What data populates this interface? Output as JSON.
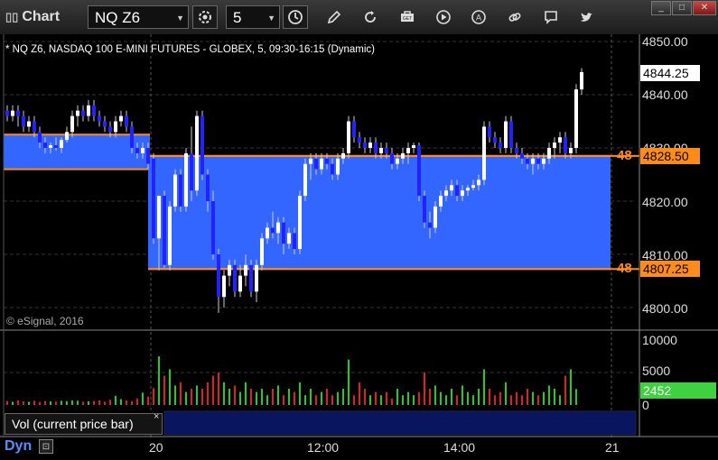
{
  "app": {
    "title": "Chart",
    "grip_icon": "grip-icon"
  },
  "toolbar": {
    "symbol": "NQ Z6",
    "interval": "5",
    "buttons": [
      "settings-gear-icon",
      "clock-icon",
      "pencil-draw-icon",
      "refresh-icon",
      "toolbox-icon",
      "play-icon",
      "alert-icon",
      "link-icon",
      "comment-icon",
      "twitter-icon"
    ],
    "get_label": "GET",
    "alert_label": "A"
  },
  "window": {
    "min": "_",
    "max": "□",
    "close": "✕"
  },
  "chart": {
    "info": "* NQ Z6, NASDAQ 100 E-MINI FUTURES - GLOBEX, 5, 09:30-16:15 (Dynamic)",
    "copyright": "© eSignal, 2016",
    "price_axis": [
      "4850.00",
      "4840.00",
      "4830.00",
      "4820.00",
      "4810.00",
      "4800.00"
    ],
    "volume_axis": [
      "10000",
      "5000",
      "0"
    ],
    "time_axis": [
      "20",
      "12:00",
      "14:00",
      "21"
    ],
    "last_price": "4844.25",
    "level_high": "4828.50",
    "level_low": "4807.25",
    "level_label": "48",
    "last_volume": "2452",
    "colors": {
      "up": "#ffffff",
      "down": "#2222ff",
      "zone": "#3366ff",
      "level": "#ff8c1a",
      "vol_up": "#1fcf1f",
      "vol_down": "#e02020"
    }
  },
  "volume_panel": {
    "label": "Vol (current price bar)",
    "close": "×"
  },
  "status": {
    "dyn": "Dyn"
  },
  "chart_data": {
    "type": "candlestick",
    "ylim": [
      4797,
      4852
    ],
    "levels": [
      4828.5,
      4807.25
    ],
    "zones": [
      {
        "x_from": 0,
        "x_to": 27,
        "y_from": 4826,
        "y_to": 4832.5
      },
      {
        "x_from": 27,
        "x_to": 112,
        "y_from": 4807.25,
        "y_to": 4828.5
      }
    ],
    "x_ticks": {
      "20": 27,
      "12:00": 59,
      "14:00": 84,
      "21": 112
    },
    "candles": [
      [
        4837,
        4838,
        4835,
        4836
      ],
      [
        4836,
        4838,
        4835,
        4837
      ],
      [
        4837,
        4838,
        4834,
        4836
      ],
      [
        4836,
        4837,
        4833,
        4834
      ],
      [
        4834,
        4836,
        4833,
        4835
      ],
      [
        4835,
        4836,
        4832,
        4833
      ],
      [
        4833,
        4834,
        4830,
        4831
      ],
      [
        4831,
        4832,
        4829,
        4830
      ],
      [
        4830,
        4831,
        4829,
        4830.5
      ],
      [
        4830.5,
        4832,
        4829.5,
        4830
      ],
      [
        4830,
        4832,
        4829,
        4831.5
      ],
      [
        4831.5,
        4834,
        4831,
        4833
      ],
      [
        4833,
        4837,
        4832,
        4836
      ],
      [
        4836,
        4838,
        4834,
        4837
      ],
      [
        4837,
        4838,
        4835,
        4836
      ],
      [
        4836,
        4839,
        4835,
        4838
      ],
      [
        4838,
        4839,
        4835,
        4836
      ],
      [
        4836,
        4837,
        4834,
        4835
      ],
      [
        4835,
        4836,
        4833,
        4834
      ],
      [
        4834,
        4835,
        4832,
        4833
      ],
      [
        4833,
        4836,
        4832,
        4835
      ],
      [
        4835,
        4837,
        4834,
        4836
      ],
      [
        4836,
        4837,
        4833,
        4834
      ],
      [
        4834,
        4835,
        4829,
        4830
      ],
      [
        4830,
        4831,
        4828,
        4829
      ],
      [
        4829,
        4831,
        4828,
        4830
      ],
      [
        4830,
        4831,
        4826,
        4827
      ],
      [
        4828,
        4829,
        4812,
        4813
      ],
      [
        4813,
        4821,
        4807,
        4821
      ],
      [
        4821,
        4822,
        4807.5,
        4808
      ],
      [
        4808,
        4820,
        4807,
        4819
      ],
      [
        4819,
        4826,
        4818,
        4825
      ],
      [
        4825,
        4826,
        4818,
        4819
      ],
      [
        4819,
        4830,
        4818,
        4829
      ],
      [
        4829,
        4834,
        4820,
        4822
      ],
      [
        4822,
        4837,
        4821,
        4836
      ],
      [
        4836,
        4837,
        4824,
        4825
      ],
      [
        4825,
        4826,
        4818,
        4820
      ],
      [
        4820,
        4822,
        4809,
        4810
      ],
      [
        4810,
        4811,
        4799,
        4802
      ],
      [
        4802,
        4807,
        4800,
        4806
      ],
      [
        4806,
        4809,
        4804,
        4808
      ],
      [
        4808,
        4809,
        4802,
        4803
      ],
      [
        4803,
        4808,
        4802,
        4806
      ],
      [
        4806,
        4810,
        4804,
        4808
      ],
      [
        4808,
        4809,
        4802,
        4803
      ],
      [
        4803,
        4809,
        4801,
        4808
      ],
      [
        4808,
        4814,
        4807,
        4813
      ],
      [
        4813,
        4816,
        4812,
        4815
      ],
      [
        4815,
        4818,
        4813,
        4814
      ],
      [
        4814,
        4817,
        4812,
        4816
      ],
      [
        4816,
        4817,
        4810,
        4812
      ],
      [
        4812,
        4815,
        4811,
        4814
      ],
      [
        4814,
        4815,
        4810,
        4811
      ],
      [
        4811,
        4822,
        4810,
        4821
      ],
      [
        4821,
        4828,
        4820,
        4827
      ],
      [
        4827,
        4829,
        4824,
        4828
      ],
      [
        4828,
        4829,
        4825,
        4826
      ],
      [
        4826,
        4829,
        4825,
        4828
      ],
      [
        4828,
        4829,
        4826,
        4827
      ],
      [
        4827,
        4828,
        4824,
        4825
      ],
      [
        4825,
        4829,
        4824,
        4828
      ],
      [
        4828,
        4830,
        4827,
        4829
      ],
      [
        4829,
        4836,
        4828,
        4835
      ],
      [
        4835,
        4836,
        4831,
        4832
      ],
      [
        4832,
        4833,
        4830,
        4831
      ],
      [
        4831,
        4832,
        4829,
        4830
      ],
      [
        4830,
        4832,
        4829,
        4831
      ],
      [
        4831,
        4832,
        4828,
        4829
      ],
      [
        4829,
        4831,
        4828,
        4830
      ],
      [
        4830,
        4831,
        4828,
        4829
      ],
      [
        4829,
        4830,
        4826,
        4827
      ],
      [
        4827,
        4829,
        4826,
        4828
      ],
      [
        4828,
        4830,
        4827,
        4829
      ],
      [
        4829,
        4831,
        4827,
        4830
      ],
      [
        4830,
        4831,
        4829,
        4830.5
      ],
      [
        4830.5,
        4831,
        4820,
        4821
      ],
      [
        4821,
        4822,
        4815,
        4816
      ],
      [
        4816,
        4818,
        4813,
        4815
      ],
      [
        4815,
        4820,
        4814,
        4819
      ],
      [
        4819,
        4822,
        4818,
        4821
      ],
      [
        4821,
        4823,
        4820,
        4822
      ],
      [
        4822,
        4824,
        4821,
        4823
      ],
      [
        4823,
        4824,
        4820,
        4821
      ],
      [
        4821,
        4823,
        4820,
        4822
      ],
      [
        4822,
        4823,
        4821,
        4822.5
      ],
      [
        4822.5,
        4824,
        4822,
        4823
      ],
      [
        4823,
        4825,
        4822,
        4824
      ],
      [
        4824,
        4835,
        4823,
        4834
      ],
      [
        4834,
        4835,
        4831,
        4832
      ],
      [
        4832,
        4833,
        4830,
        4831
      ],
      [
        4831,
        4832,
        4829,
        4830
      ],
      [
        4830,
        4836,
        4829,
        4835
      ],
      [
        4835,
        4836,
        4829,
        4830
      ],
      [
        4830,
        4831,
        4828,
        4829
      ],
      [
        4829,
        4830,
        4827,
        4828
      ],
      [
        4828,
        4829,
        4826,
        4827
      ],
      [
        4827,
        4829,
        4825,
        4828
      ],
      [
        4828,
        4829,
        4826,
        4827
      ],
      [
        4827,
        4829,
        4826,
        4828
      ],
      [
        4828,
        4831,
        4827,
        4830
      ],
      [
        4830,
        4832,
        4828,
        4831
      ],
      [
        4831,
        4833,
        4829,
        4832
      ],
      [
        4832,
        4833,
        4828,
        4829
      ],
      [
        4829,
        4831,
        4828,
        4830
      ],
      [
        4830,
        4842,
        4829,
        4841
      ],
      [
        4841,
        4845,
        4840,
        4844.25
      ]
    ],
    "volumes": [
      600,
      500,
      700,
      550,
      500,
      650,
      450,
      600,
      550,
      500,
      650,
      600,
      700,
      650,
      500,
      550,
      600,
      700,
      500,
      800,
      1400,
      900,
      700,
      600,
      1000,
      1900,
      1300,
      2600,
      7500,
      4500,
      5500,
      3000,
      3500,
      2000,
      2500,
      3000,
      2500,
      3500,
      4500,
      5000,
      3500,
      2500,
      3000,
      2000,
      3500,
      2500,
      2000,
      2500,
      1500,
      2500,
      3000,
      1500,
      2500,
      2000,
      3500,
      1500,
      2500,
      1500,
      2000,
      2500,
      1500,
      2000,
      2500,
      7000,
      1500,
      3500,
      2500,
      1500,
      2000,
      1500,
      2000,
      1000,
      2500,
      1500,
      2000,
      1500,
      2000,
      5000,
      2500,
      3000,
      2000,
      1500,
      2500,
      1500,
      3000,
      2000,
      1500,
      2500,
      5500,
      2500,
      1500,
      2000,
      3500,
      1500,
      2000,
      1500,
      2500,
      2000,
      1500,
      2000,
      3000,
      2500,
      1500,
      4500,
      5500,
      2452
    ]
  }
}
